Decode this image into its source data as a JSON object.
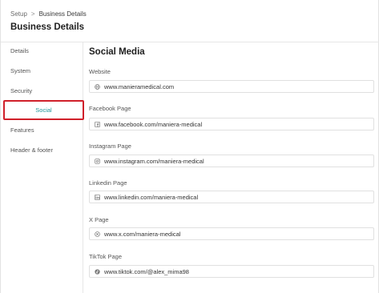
{
  "breadcrumb": {
    "root": "Setup",
    "separator": ">",
    "current": "Business Details"
  },
  "page_title": "Business Details",
  "sidebar": {
    "items": [
      {
        "label": "Details"
      },
      {
        "label": "System"
      },
      {
        "label": "Security"
      },
      {
        "label": "Social",
        "active": true
      },
      {
        "label": "Features"
      },
      {
        "label": "Header & footer"
      }
    ]
  },
  "main": {
    "section_title": "Social Media",
    "fields": [
      {
        "label": "Website",
        "value": "www.manieramedical.com",
        "icon": "globe-icon"
      },
      {
        "label": "Facebook Page",
        "value": "www.facebook.com/maniera-medical",
        "icon": "facebook-icon"
      },
      {
        "label": "Instagram Page",
        "value": "www.instagram.com/maniera-medical",
        "icon": "instagram-icon"
      },
      {
        "label": "Linkedin Page",
        "value": "www.linkedin.com/maniera-medical",
        "icon": "linkedin-icon"
      },
      {
        "label": "X Page",
        "value": "www.x.com/maniera-medical",
        "icon": "x-icon"
      },
      {
        "label": "TikTok Page",
        "value": "www.tiktok.com/@alex_mima98",
        "icon": "tiktok-icon"
      }
    ]
  },
  "colors": {
    "accent": "#22969a",
    "highlight": "#d0202a",
    "border": "#e0e0e0"
  }
}
